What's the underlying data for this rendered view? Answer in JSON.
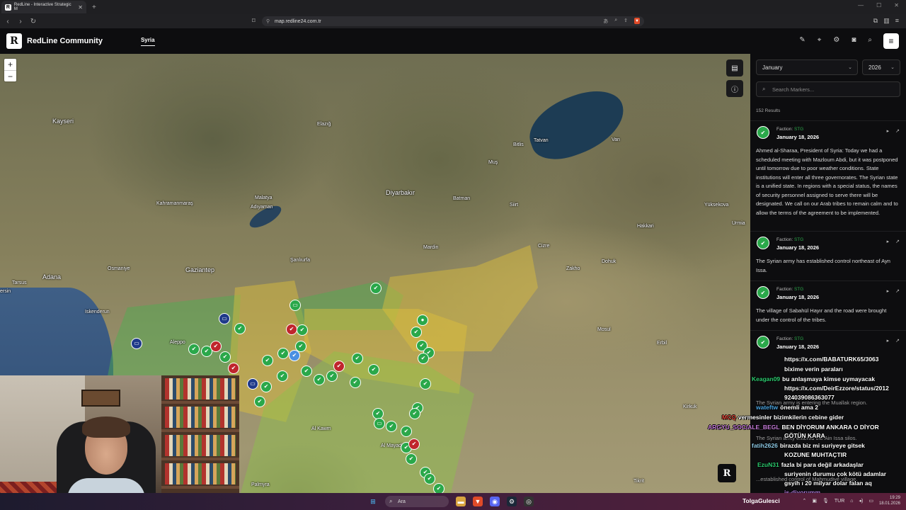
{
  "browser": {
    "tab_title": "RedLine - Interactive Strategic M",
    "tab_favicon": "R",
    "url": "map.redline24.com.tr",
    "icons": [
      "back-icon",
      "forward-icon",
      "reload-icon",
      "bookmark-icon",
      "lock-icon",
      "translate-icon",
      "zoom-icon",
      "share-icon",
      "brave-shield-icon"
    ]
  },
  "app": {
    "logo": "R",
    "brand": "RedLine Community",
    "nav_tab": "Syria",
    "header_icons": [
      "pen-icon",
      "pin-icon",
      "gear-icon",
      "camera-icon",
      "search-icon",
      "menu-icon"
    ]
  },
  "map": {
    "zoom_in": "+",
    "zoom_out": "−",
    "labels": [
      {
        "text": "Kayseri",
        "big": true
      },
      {
        "text": "Malatya"
      },
      {
        "text": "Elazığ"
      },
      {
        "text": "Diyarbakır",
        "big": true
      },
      {
        "text": "Batman"
      },
      {
        "text": "Adıyaman"
      },
      {
        "text": "Kahramanmaraş"
      },
      {
        "text": "Gaziantep",
        "big": true
      },
      {
        "text": "Şanlıurfa"
      },
      {
        "text": "Adana",
        "big": true
      },
      {
        "text": "Osmaniye"
      },
      {
        "text": "Mardin"
      },
      {
        "text": "Tatvan"
      },
      {
        "text": "Van"
      },
      {
        "text": "Mosul"
      },
      {
        "text": "Erbil"
      },
      {
        "text": "Kirkuk"
      },
      {
        "text": "Iskenderun"
      },
      {
        "text": "Aleppo"
      },
      {
        "text": "Tarsus"
      },
      {
        "text": "Urmia"
      },
      {
        "text": "Siirt"
      },
      {
        "text": "Muş"
      },
      {
        "text": "Bitlis"
      },
      {
        "text": "Yüksekova"
      },
      {
        "text": "Zakho"
      },
      {
        "text": "Dohuk"
      },
      {
        "text": "Hakkari"
      },
      {
        "text": "Cizre"
      },
      {
        "text": "Tikrit"
      },
      {
        "text": "Palmyra"
      },
      {
        "text": "Al Mayadin"
      },
      {
        "text": "Al Kawm"
      },
      {
        "text": "ersin"
      }
    ]
  },
  "sidebar": {
    "month": "January",
    "year": "2026",
    "search_placeholder": "Search Markers...",
    "results": "152 Results",
    "faction_label": "Faction:",
    "entries": [
      {
        "faction": "STG",
        "date": "January 18, 2026",
        "body": "Ahmed al-Sharaa, President of Syria: Today we had a scheduled meeting with Mazloum Abdi, but it was postponed until tomorrow due to poor weather conditions. State institutions will enter all three governorates. The Syrian state is a unified state. In regions with a special status, the names of security personnel assigned to serve there will be designated. We call on our Arab tribes to remain calm and to allow the terms of the agreement to be implemented."
      },
      {
        "faction": "STG",
        "date": "January 18, 2026",
        "body": "The Syrian army has established control northeast of Ayn Issa."
      },
      {
        "faction": "STG",
        "date": "January 18, 2026",
        "body": "The village of Sabahül Hayır and the road were brought under the control of the tribes."
      },
      {
        "faction": "STG",
        "date": "January 18, 2026",
        "body": ""
      }
    ]
  },
  "chat": [
    {
      "user": "",
      "msg": "https://x.com/BABATURK65/3063",
      "color": "#ffffff"
    },
    {
      "user": "",
      "msg": "bixime verin paraları",
      "color": "#b07ad9"
    },
    {
      "user": "Keagan09",
      "msg": "bu anlaşmaya kimse uymayacak",
      "color": "#2ecc71"
    },
    {
      "user": "",
      "msg": "https://x.com/DeirEzzore/status/2012",
      "color": "#2ecc71"
    },
    {
      "user": "",
      "msg": "924039086363077",
      "color": "#ffffff"
    },
    {
      "user": "wateftw",
      "msg": "önemli ama 2",
      "color": "#4aa3df"
    },
    {
      "user": "MCQ",
      "msg": "vermesinler bizimkilerin cebine gider",
      "color": "#e74c3c"
    },
    {
      "user": "ARGYU_SOCIALE_BEGL",
      "msg": "BEN DİYORUM ANKARA O DİYOR",
      "color": "#c77ddb"
    },
    {
      "user": "",
      "msg": "GÖTÜN KARA",
      "color": "#ffffff"
    },
    {
      "user": "fatih2626",
      "msg": "birazda biz mi suriyeye gitsek",
      "color": "#8ecae6"
    },
    {
      "user": "",
      "msg": "KOZUNE MUHTAÇTIR",
      "color": "#e74c3c"
    },
    {
      "user": "EzuN31",
      "msg": "fazla bi para değil arkadaşlar",
      "color": "#2ecc71"
    },
    {
      "user": "",
      "msg": "suriyenin durumu çok kötü adamlar",
      "color": "#ffffff"
    },
    {
      "user": "",
      "msg": "gsyih ı 20 milyar dolar falan aq",
      "color": "#ffffff"
    },
    {
      "user": "",
      "msg": "is-diyorumm",
      "color": "#b07ad9"
    }
  ],
  "chat_bg_lines": [
    "The Syrian army is entering the Muallak region.",
    "The Syrian army entered the Ain Issa silos.",
    "...established control of Mahmudiye village."
  ],
  "taskbar": {
    "search": "Ara",
    "lang": "TUR",
    "time": "19:29",
    "date": "18.01.2026",
    "user": "TolgaGulesci"
  }
}
